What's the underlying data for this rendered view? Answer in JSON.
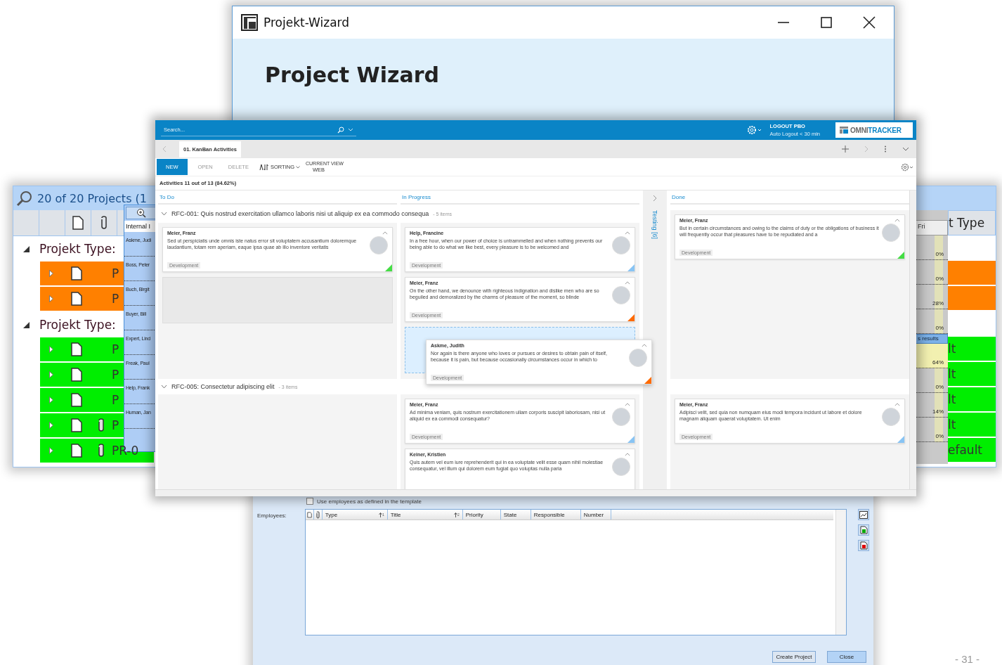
{
  "wizard_window": {
    "title": "Projekt-Wizard",
    "heading": "Project Wizard"
  },
  "projects_window": {
    "title": "20 of 20 Projects (1",
    "groups": [
      {
        "label": "Projekt Type:",
        "expanded": true,
        "rows": [
          {
            "code": "P",
            "color": "#ff8000",
            "attachment": false
          },
          {
            "code": "P",
            "color": "#ff8000",
            "attachment": false
          }
        ]
      },
      {
        "label": "Projekt Type:",
        "expanded": true,
        "rows": [
          {
            "code": "P",
            "color": "#00ee00",
            "attachment": false,
            "type": "lt"
          },
          {
            "code": "P",
            "color": "#00ee00",
            "attachment": false,
            "type": "lt"
          },
          {
            "code": "P",
            "color": "#00ee00",
            "attachment": false,
            "type": "lt"
          },
          {
            "code": "P",
            "color": "#00ee00",
            "attachment": true,
            "type": "lt"
          },
          {
            "code": "PR-0",
            "color": "#00ee00",
            "attachment": true,
            "type": "efault"
          }
        ]
      }
    ],
    "type_header": "t Type",
    "employee_picker": {
      "filter": "Internal I",
      "names": [
        "Askme, Judi",
        "Boss, Peter",
        "Buch, Birgit",
        "Buyer, Bill",
        "Expert, Lind",
        "Freak, Paul",
        "Help, Frank",
        "Human, Jan"
      ]
    },
    "percent_column": {
      "header": "Fri",
      "cells": [
        {
          "kind": "percent",
          "text": "0%",
          "highlighted": false
        },
        {
          "kind": "percent",
          "text": "0%",
          "highlighted": false
        },
        {
          "kind": "percent",
          "text": "28%",
          "highlighted": false
        },
        {
          "kind": "percent",
          "text": "0%",
          "highlighted": false
        },
        {
          "kind": "results",
          "text": "s results",
          "highlighted": false
        },
        {
          "kind": "percent",
          "text": "64%",
          "highlighted": true
        },
        {
          "kind": "percent",
          "text": "0%",
          "highlighted": false
        },
        {
          "kind": "percent",
          "text": "14%",
          "highlighted": false
        },
        {
          "kind": "percent",
          "text": "0%",
          "highlighted": false
        }
      ]
    }
  },
  "kanban": {
    "search": {
      "placeholder": "Search..."
    },
    "logout": "LOGOUT PBO",
    "auto_logout": "Auto Logout < 30 min",
    "logo": {
      "first": "OMNI",
      "second": "TRACKER"
    },
    "tabs": [
      {
        "label": "01. KanBan Activities",
        "selected": true
      }
    ],
    "toolbar": [
      {
        "label": "NEW",
        "kind": "primary"
      },
      {
        "label": "OPEN",
        "kind": "disabled"
      },
      {
        "label": "DELETE",
        "kind": "disabled"
      },
      {
        "label": "SORTING",
        "kind": "sort"
      }
    ],
    "view": {
      "caption": "CURRENT VIEW",
      "value": "WEB"
    },
    "summary": "Activities 11 out of 13 (84.62%)",
    "columns": [
      {
        "title": "To Do",
        "collapsed": false
      },
      {
        "title": "In Progress",
        "collapsed": false
      },
      {
        "title": "Testing [6]",
        "collapsed": true
      },
      {
        "title": "Done",
        "collapsed": false
      }
    ],
    "swimlanes": [
      {
        "title": "RFC-001: Quis nostrud exercitation ullamco laboris nisi ut aliquip ex ea commodo consequa",
        "count": "- 5 items",
        "expanded": true,
        "cells": [
          [
            {
              "kind": "card",
              "name": "Meier, Franz",
              "text": "Sed ut perspiciatis unde omnis iste natus error sit voluptatem accusantium doloremque laudantium, totam rem aperiam, eaque ipsa quae ab illo inventore veritatis",
              "tag": "Development",
              "color": "#44dd44"
            },
            {
              "kind": "drop-zone"
            }
          ],
          [
            {
              "kind": "card",
              "name": "Help, Francine",
              "text": "In a free hour, when our power of choice is untrammelled and when nothing prevents our being able to do what we like best, every pleasure is to be welcomed and",
              "tag": "Development",
              "color": "#88c4f4"
            },
            {
              "kind": "card",
              "name": "Meier, Franz",
              "text": "On the other hand, we denounce with righteous indignation and dislike men who are so beguiled and demoralized by the charms of pleasure of the moment, so blinde",
              "tag": "Development",
              "color": "#ff6a00"
            },
            {
              "kind": "placeholder"
            }
          ],
          [],
          [
            {
              "kind": "card",
              "name": "Meier, Franz",
              "text": "But in certain circumstances and owing to the claims of duty or the obligations of business it will frequently occur that pleasures have to be repudiated and a",
              "tag": "Development",
              "color": "#44dd44"
            }
          ]
        ],
        "dragged_card": {
          "name": "Askme, Judith",
          "text": "Nor again is there anyone who loves or pursues or desires to obtain pain of itself, because it is pain, but because occasionally circumstances occur in which to",
          "tag": "Development",
          "color": "#ff6a00"
        }
      },
      {
        "title": "RFC-005: Consectetur adipiscing elit",
        "count": "- 3 items",
        "expanded": true,
        "cells": [
          [],
          [
            {
              "kind": "card",
              "name": "Meier, Franz",
              "text": "Ad minima veniam, quis nostrum exercitationem ullam corporis suscipit laboriosam, nisi ut aliquid ex ea commodi consequatur?",
              "tag": "Development",
              "color": "#88c4f4"
            },
            {
              "kind": "card",
              "name": "Keiner, Kristien",
              "text": "Quis autem vel eum iure reprehenderit qui in ea voluptate velit esse quam nihil molestiae consequatur, vel illum qui dolorem eum fugiat quo voluptas nulla paria"
            }
          ],
          [],
          [
            {
              "kind": "card",
              "name": "Meier, Franz",
              "text": "Adipisci velit, sed quia non numquam eius modi tempora incidunt ut labore et dolore magnam aliquam quaerat voluptatem. Ut enim",
              "tag": "Development",
              "color": "#88c4f4"
            }
          ]
        ]
      }
    ]
  },
  "employees_dialog": {
    "template_option": {
      "label": "Use employees as defined in the template",
      "checked": false
    },
    "label": "Employees:",
    "columns": [
      {
        "kind": "icon-doc"
      },
      {
        "kind": "icon-clip"
      },
      {
        "kind": "text",
        "label": "Type",
        "sort": "1"
      },
      {
        "kind": "text",
        "label": "Title",
        "sort": "2"
      },
      {
        "kind": "text",
        "label": "Priority"
      },
      {
        "kind": "text",
        "label": "State"
      },
      {
        "kind": "text",
        "label": "Responsible"
      },
      {
        "kind": "text",
        "label": "Number"
      }
    ],
    "buttons": [
      {
        "label": "Create Project",
        "default": false
      },
      {
        "label": "Close",
        "default": true
      }
    ]
  },
  "page_number": "- 31 -"
}
